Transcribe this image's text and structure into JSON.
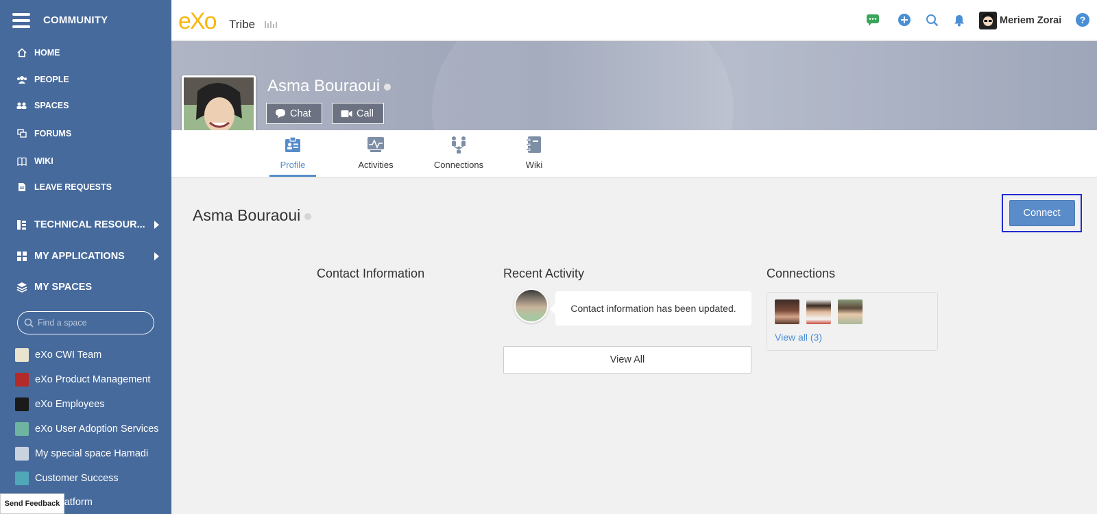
{
  "sidebar": {
    "title": "COMMUNITY",
    "nav": [
      {
        "label": "HOME",
        "icon": "home-icon"
      },
      {
        "label": "PEOPLE",
        "icon": "people-icon"
      },
      {
        "label": "SPACES",
        "icon": "spaces-icon"
      },
      {
        "label": "FORUMS",
        "icon": "forums-icon"
      },
      {
        "label": "WIKI",
        "icon": "wiki-icon"
      },
      {
        "label": "LEAVE REQUESTS",
        "icon": "document-icon"
      }
    ],
    "groups": [
      {
        "label": "TECHNICAL RESOUR...",
        "icon": "tree-icon"
      },
      {
        "label": "MY APPLICATIONS",
        "icon": "apps-grid-icon"
      },
      {
        "label": "MY SPACES",
        "icon": "layers-icon"
      }
    ],
    "search_placeholder": "Find a space",
    "spaces": [
      {
        "label": "eXo CWI Team",
        "color": "#e8e4d0"
      },
      {
        "label": "eXo Product Management",
        "color": "#b22a2a"
      },
      {
        "label": "eXo Employees",
        "color": "#1a1a1a"
      },
      {
        "label": "eXo User Adoption Services",
        "color": "#6fb4a0"
      },
      {
        "label": "My special space Hamadi",
        "color": "#c9d3e0"
      },
      {
        "label": "Customer Success",
        "color": "#4fa7b8"
      },
      {
        "label": "eXo Platform",
        "color": "#2a6ea8"
      }
    ],
    "feedback": "Send Feedback"
  },
  "topbar": {
    "logo": "eXo",
    "brand": "Tribe",
    "user_name": "Meriem Zorai",
    "help": "?",
    "colors": {
      "chat": "#3aa55a",
      "plus": "#4a8fd6",
      "icons": "#4a8fd6"
    }
  },
  "profile": {
    "name": "Asma Bouraoui",
    "chat_label": "Chat",
    "call_label": "Call",
    "tabs": [
      {
        "label": "Profile",
        "icon": "profile-card-icon"
      },
      {
        "label": "Activities",
        "icon": "activity-chart-icon"
      },
      {
        "label": "Connections",
        "icon": "connections-icon"
      },
      {
        "label": "Wiki",
        "icon": "notebook-icon"
      }
    ],
    "active_tab": "Profile"
  },
  "main": {
    "name": "Asma Bouraoui",
    "connect_label": "Connect",
    "contact_title": "Contact Information",
    "recent_title": "Recent Activity",
    "activity_text": "Contact information has been updated.",
    "view_all_label": "View All",
    "connections_title": "Connections",
    "connections_link": "View all (3)"
  }
}
